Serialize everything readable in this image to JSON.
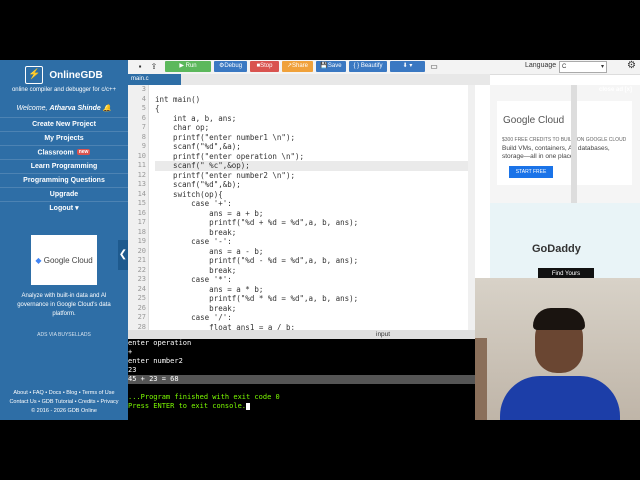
{
  "sidebar": {
    "brand": "OnlineGDB",
    "tagline": "online compiler and debugger for c/c++",
    "welcome_prefix": "Welcome,",
    "user_name": "Atharva Shinde",
    "nav": [
      {
        "label": "Create New Project"
      },
      {
        "label": "My Projects"
      },
      {
        "label": "Classroom",
        "badge": "new"
      },
      {
        "label": "Learn Programming"
      },
      {
        "label": "Programming Questions"
      },
      {
        "label": "Upgrade"
      },
      {
        "label": "Logout"
      }
    ],
    "ad_logo": "Google Cloud",
    "ad_text": "Analyze with built-in data and AI governance in Google Cloud's data platform.",
    "ads_via": "ADS VIA BUYSELLADS",
    "footer": {
      "line1": "About • FAQ • Docs • Blog • Terms of Use",
      "line2": "Contact Us • GDB Tutorial • Credits • Privacy",
      "line3": "© 2016 - 2026 GDB Online"
    }
  },
  "toolbar": {
    "run": "Run",
    "debug": "Debug",
    "stop": "Stop",
    "share": "Share",
    "save": "Save",
    "beautify": "{ } Beautify",
    "language_label": "Language",
    "language_value": "C",
    "colors": {
      "run": "#5cb85c",
      "debug": "#3a78c2",
      "stop": "#d9534f",
      "share": "#f0a13a",
      "save": "#3a78c2",
      "beautify": "#3a78c2",
      "download": "#3a78c2"
    }
  },
  "file_tab": "main.c",
  "editor": {
    "lines": [
      {
        "n": "3",
        "code": ""
      },
      {
        "n": "4",
        "code": "int main()"
      },
      {
        "n": "5",
        "code": "{"
      },
      {
        "n": "6",
        "code": "    int a, b, ans;"
      },
      {
        "n": "7",
        "code": "    char op;"
      },
      {
        "n": "8",
        "code": "    printf(\"enter number1 \\n\");"
      },
      {
        "n": "9",
        "code": "    scanf(\"%d\",&a);"
      },
      {
        "n": "10",
        "code": "    printf(\"enter operation \\n\");"
      },
      {
        "n": "11",
        "code": "    scanf(\" %c\",&op);"
      },
      {
        "n": "12",
        "code": "    printf(\"enter number2 \\n\");"
      },
      {
        "n": "13",
        "code": "    scanf(\"%d\",&b);"
      },
      {
        "n": "14",
        "code": "    switch(op){"
      },
      {
        "n": "15",
        "code": "        case '+':"
      },
      {
        "n": "16",
        "code": "            ans = a + b;"
      },
      {
        "n": "17",
        "code": "            printf(\"%d + %d = %d\",a, b, ans);"
      },
      {
        "n": "18",
        "code": "            break;"
      },
      {
        "n": "19",
        "code": "        case '-':"
      },
      {
        "n": "20",
        "code": "            ans = a - b;"
      },
      {
        "n": "21",
        "code": "            printf(\"%d - %d = %d\",a, b, ans);"
      },
      {
        "n": "22",
        "code": "            break;"
      },
      {
        "n": "23",
        "code": "        case '*':"
      },
      {
        "n": "24",
        "code": "            ans = a * b;"
      },
      {
        "n": "25",
        "code": "            printf(\"%d * %d = %d\",a, b, ans);"
      },
      {
        "n": "26",
        "code": "            break;"
      },
      {
        "n": "27",
        "code": "        case '/':"
      },
      {
        "n": "28",
        "code": "            float ans1 = a / b;"
      }
    ]
  },
  "console": {
    "input_label": "input",
    "lines": [
      {
        "text": "enter operation"
      },
      {
        "text": "+"
      },
      {
        "text": "enter number2"
      },
      {
        "text": "23"
      },
      {
        "text": "45 + 23 = 68"
      },
      {
        "text": ""
      },
      {
        "text": "...Program finished with exit code 0"
      },
      {
        "text": "Press ENTER to exit console."
      }
    ]
  },
  "right_ad": {
    "close": "close ad [x]",
    "logo": "Google Cloud",
    "small": "$300 FREE CREDITS TO BUILD ON GOOGLE CLOUD",
    "body": "Build VMs, containers, AI, databases, storage—all in one place.",
    "button": "START FREE",
    "logo2": "GoDaddy",
    "button2": "Find Yours"
  }
}
